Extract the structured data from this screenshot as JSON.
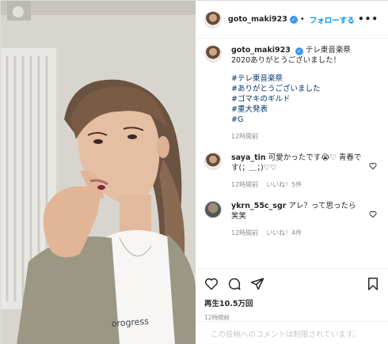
{
  "header": {
    "username": "goto_maki923",
    "follow_label": "フォローする",
    "more_label": "•••"
  },
  "caption": {
    "username": "goto_maki923",
    "text": "テレ東音楽祭2020ありがとうございました！",
    "hashtags": [
      "#テレ東音楽祭",
      "#ありがとうございました",
      "#ゴマキのギルド",
      "#重大発表",
      "#G"
    ],
    "time": "12時間前"
  },
  "comments": [
    {
      "username": "saya_tin",
      "text": "可愛かったです😭♡ 青春です(；＿；)♡♡",
      "time": "12時間前",
      "likes": "いいね！5件"
    },
    {
      "username": "ykrn_55c_sgr",
      "text": "アレ？って思ったら 笑笑",
      "time": "12時間前",
      "likes": "いいね！4件"
    }
  ],
  "stats": {
    "views": "再生10.5万回",
    "posted": "12時間前"
  },
  "footer": {
    "restricted": "この投稿へのコメントは制限されています。"
  },
  "icons": [
    "heart-icon",
    "comment-icon",
    "share-icon",
    "bookmark-icon",
    "verified-icon"
  ]
}
